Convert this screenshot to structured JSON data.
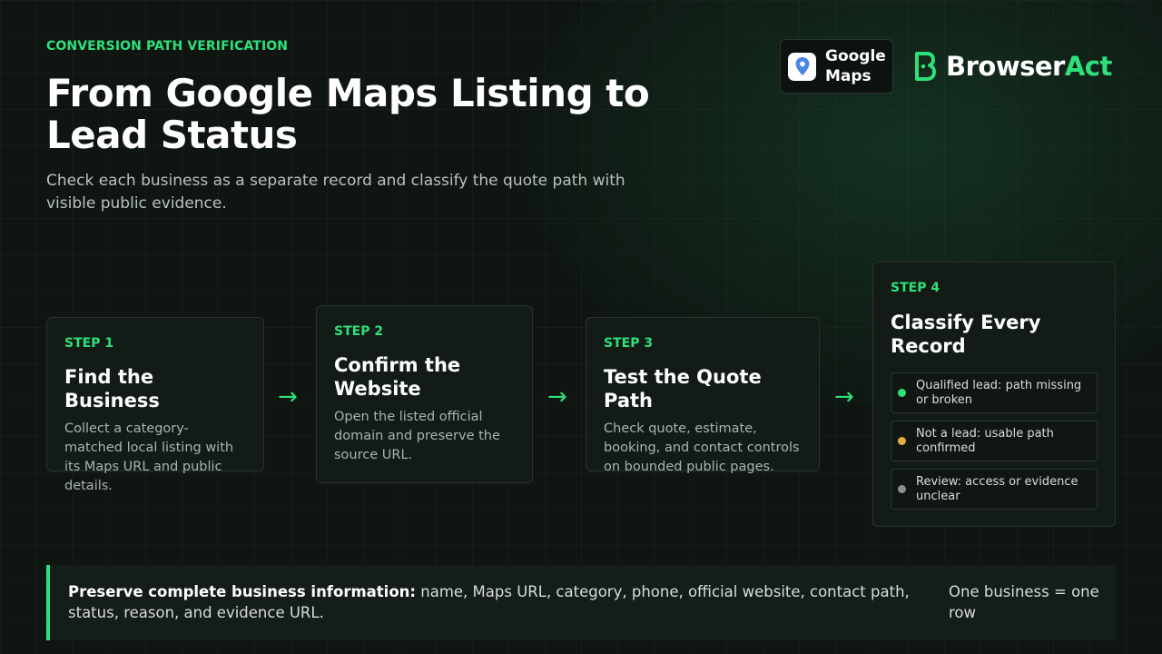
{
  "header": {
    "eyebrow": "CONVERSION PATH VERIFICATION",
    "title": "From Google Maps Listing to Lead Status",
    "subtitle": "Check each business as a separate record and classify the quote path with visible public evidence."
  },
  "badges": {
    "google_maps": "Google Maps",
    "brand_name_prefix": "Browser",
    "brand_name_suffix": "Act"
  },
  "steps": [
    {
      "label": "STEP 1",
      "title": "Find the Business",
      "description": "Collect a category-matched local listing with its Maps URL and public details."
    },
    {
      "label": "STEP 2",
      "title": "Confirm the Website",
      "description": "Open the listed official domain and preserve the source URL."
    },
    {
      "label": "STEP 3",
      "title": "Test the Quote Path",
      "description": "Check quote, estimate, booking, and contact controls on bounded public pages."
    },
    {
      "label": "STEP 4",
      "title": "Classify Every Record"
    }
  ],
  "arrows": [
    "→",
    "→",
    "→"
  ],
  "classifications": [
    {
      "text": "Qualified lead: path missing or broken",
      "color": "#2ee07a"
    },
    {
      "text": "Not a lead: usable path confirmed",
      "color": "#e8a94a"
    },
    {
      "text": "Review: access or evidence unclear",
      "color": "#8a918d"
    }
  ],
  "footer": {
    "bold": "Preserve complete business information:",
    "text": " name, Maps URL, category, phone, official website, contact path, status, reason, and evidence URL.",
    "side": "One business = one row"
  },
  "colors": {
    "accent": "#2ee07a",
    "background": "#0f1612"
  }
}
